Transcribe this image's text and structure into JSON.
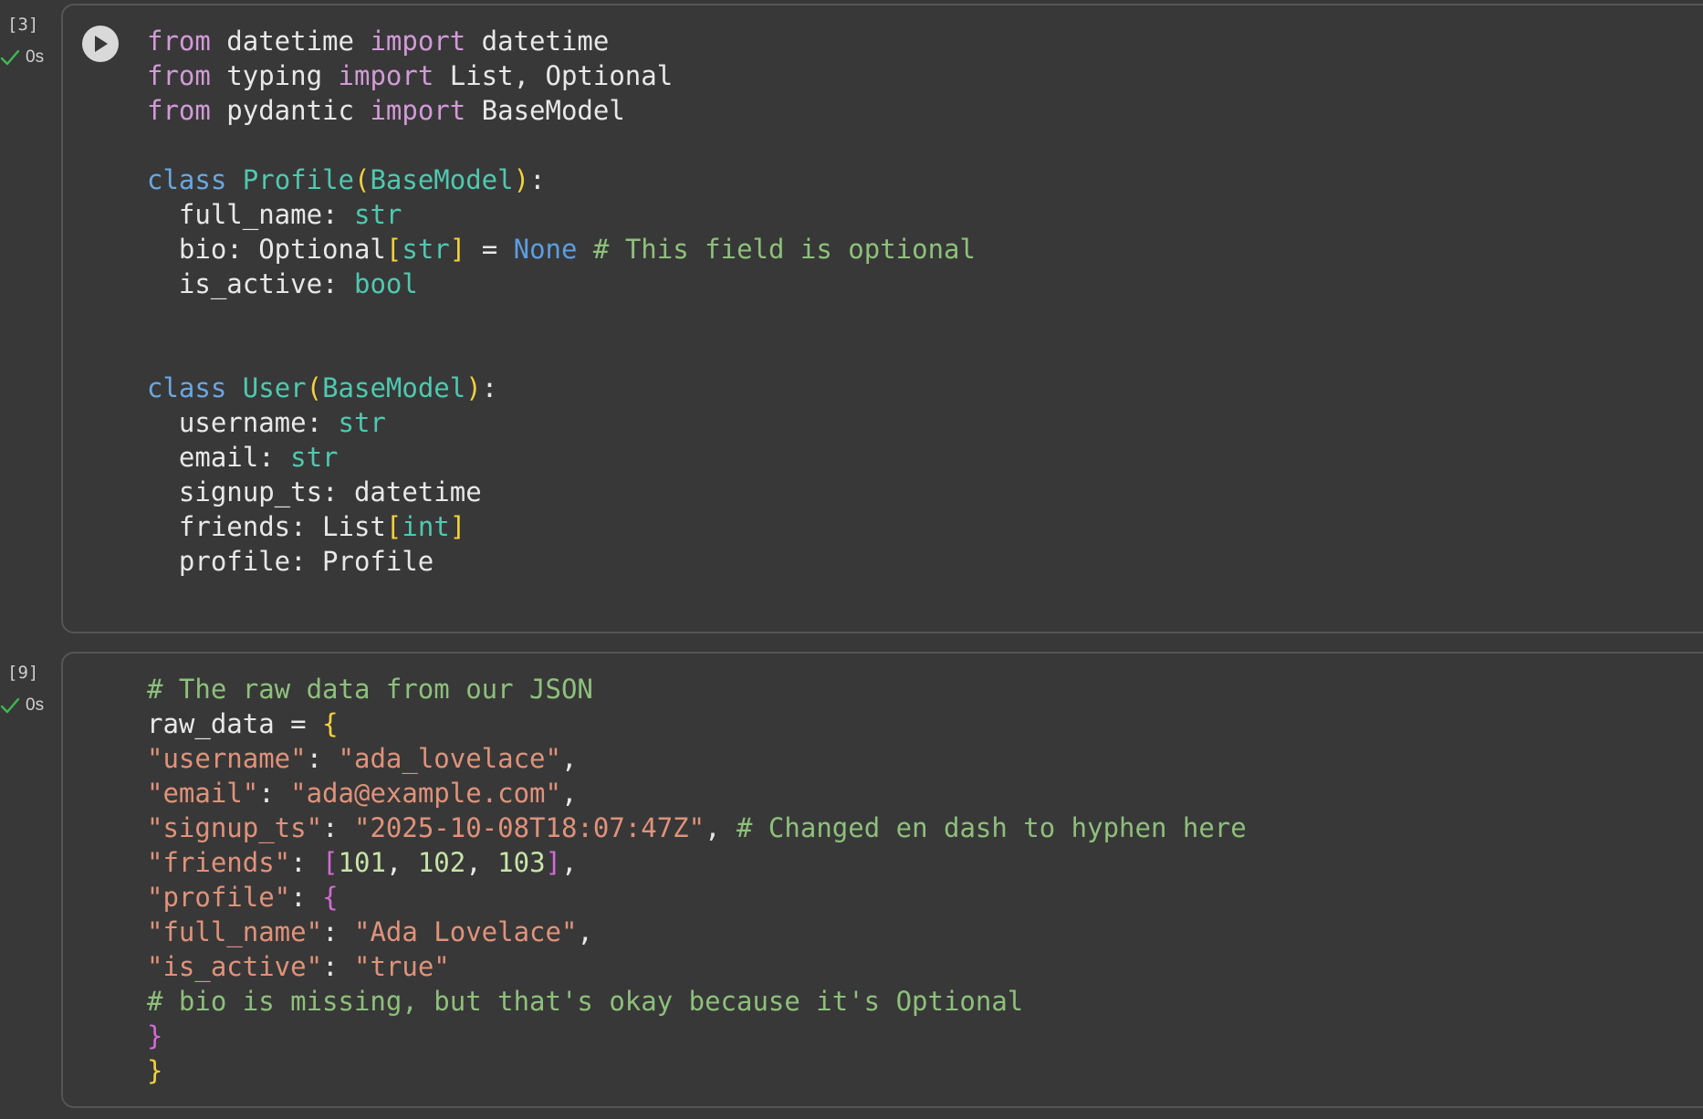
{
  "cells": [
    {
      "exec_count": "[3]",
      "status": "0s",
      "lines": [
        [
          {
            "t": "from",
            "c": "kw"
          },
          {
            "t": " datetime ",
            "c": ""
          },
          {
            "t": "import",
            "c": "kw"
          },
          {
            "t": " datetime",
            "c": ""
          }
        ],
        [
          {
            "t": "from",
            "c": "kw"
          },
          {
            "t": " typing ",
            "c": ""
          },
          {
            "t": "import",
            "c": "kw"
          },
          {
            "t": " List, Optional",
            "c": ""
          }
        ],
        [
          {
            "t": "from",
            "c": "kw"
          },
          {
            "t": " pydantic ",
            "c": ""
          },
          {
            "t": "import",
            "c": "kw"
          },
          {
            "t": " BaseModel",
            "c": ""
          }
        ],
        [],
        [
          {
            "t": "class",
            "c": "cls-kw"
          },
          {
            "t": " ",
            "c": ""
          },
          {
            "t": "Profile",
            "c": "cls-name"
          },
          {
            "t": "(",
            "c": "paren"
          },
          {
            "t": "BaseModel",
            "c": "cls-name"
          },
          {
            "t": ")",
            "c": "paren"
          },
          {
            "t": ":",
            "c": ""
          }
        ],
        [
          {
            "t": "  full_name: ",
            "c": ""
          },
          {
            "t": "str",
            "c": "type"
          }
        ],
        [
          {
            "t": "  bio: Optional",
            "c": ""
          },
          {
            "t": "[",
            "c": "paren"
          },
          {
            "t": "str",
            "c": "type"
          },
          {
            "t": "]",
            "c": "paren"
          },
          {
            "t": " = ",
            "c": ""
          },
          {
            "t": "None",
            "c": "none"
          },
          {
            "t": " # This field is optional",
            "c": "cm"
          }
        ],
        [
          {
            "t": "  is_active: ",
            "c": ""
          },
          {
            "t": "bool",
            "c": "type"
          }
        ],
        [],
        [],
        [
          {
            "t": "class",
            "c": "cls-kw"
          },
          {
            "t": " ",
            "c": ""
          },
          {
            "t": "User",
            "c": "cls-name"
          },
          {
            "t": "(",
            "c": "paren"
          },
          {
            "t": "BaseModel",
            "c": "cls-name"
          },
          {
            "t": ")",
            "c": "paren"
          },
          {
            "t": ":",
            "c": ""
          }
        ],
        [
          {
            "t": "  username: ",
            "c": ""
          },
          {
            "t": "str",
            "c": "type"
          }
        ],
        [
          {
            "t": "  email: ",
            "c": ""
          },
          {
            "t": "str",
            "c": "type"
          }
        ],
        [
          {
            "t": "  signup_ts: datetime",
            "c": ""
          }
        ],
        [
          {
            "t": "  friends: List",
            "c": ""
          },
          {
            "t": "[",
            "c": "paren"
          },
          {
            "t": "int",
            "c": "type"
          },
          {
            "t": "]",
            "c": "paren"
          }
        ],
        [
          {
            "t": "  profile: Profile",
            "c": ""
          }
        ]
      ]
    },
    {
      "exec_count": "[9]",
      "status": "0s",
      "lines": [
        [
          {
            "t": "# The raw data from our JSON",
            "c": "cm"
          }
        ],
        [
          {
            "t": "raw_data = ",
            "c": ""
          },
          {
            "t": "{",
            "c": "brace"
          }
        ],
        [
          {
            "t": "\"username\"",
            "c": "str"
          },
          {
            "t": ": ",
            "c": ""
          },
          {
            "t": "\"ada_lovelace\"",
            "c": "str"
          },
          {
            "t": ",",
            "c": ""
          }
        ],
        [
          {
            "t": "\"email\"",
            "c": "str"
          },
          {
            "t": ": ",
            "c": ""
          },
          {
            "t": "\"ada@example.com\"",
            "c": "str"
          },
          {
            "t": ",",
            "c": ""
          }
        ],
        [
          {
            "t": "\"signup_ts\"",
            "c": "str"
          },
          {
            "t": ": ",
            "c": ""
          },
          {
            "t": "\"2025-10-08T18:07:47Z\"",
            "c": "str"
          },
          {
            "t": ", ",
            "c": ""
          },
          {
            "t": "# Changed en dash to hyphen here",
            "c": "cm"
          }
        ],
        [
          {
            "t": "\"friends\"",
            "c": "str"
          },
          {
            "t": ": ",
            "c": ""
          },
          {
            "t": "[",
            "c": "brace-m"
          },
          {
            "t": "101",
            "c": "num"
          },
          {
            "t": ", ",
            "c": ""
          },
          {
            "t": "102",
            "c": "num"
          },
          {
            "t": ", ",
            "c": ""
          },
          {
            "t": "103",
            "c": "num"
          },
          {
            "t": "]",
            "c": "brace-m"
          },
          {
            "t": ",",
            "c": ""
          }
        ],
        [
          {
            "t": "\"profile\"",
            "c": "str"
          },
          {
            "t": ": ",
            "c": ""
          },
          {
            "t": "{",
            "c": "brace-m"
          }
        ],
        [
          {
            "t": "\"full_name\"",
            "c": "str"
          },
          {
            "t": ": ",
            "c": ""
          },
          {
            "t": "\"Ada Lovelace\"",
            "c": "str"
          },
          {
            "t": ",",
            "c": ""
          }
        ],
        [
          {
            "t": "\"is_active\"",
            "c": "str"
          },
          {
            "t": ": ",
            "c": ""
          },
          {
            "t": "\"true\"",
            "c": "str"
          }
        ],
        [
          {
            "t": "# bio is missing, but that's okay because it's Optional",
            "c": "cm"
          }
        ],
        [
          {
            "t": "}",
            "c": "brace-m"
          }
        ],
        [
          {
            "t": "}",
            "c": "brace"
          }
        ]
      ]
    }
  ],
  "colors": {
    "background": "#383838",
    "keyword": "#d29ad8",
    "class_keyword": "#6aa7e0",
    "type": "#4ec9b0",
    "comment": "#8ec07c",
    "string": "#e0927a",
    "check": "#3fb950"
  }
}
